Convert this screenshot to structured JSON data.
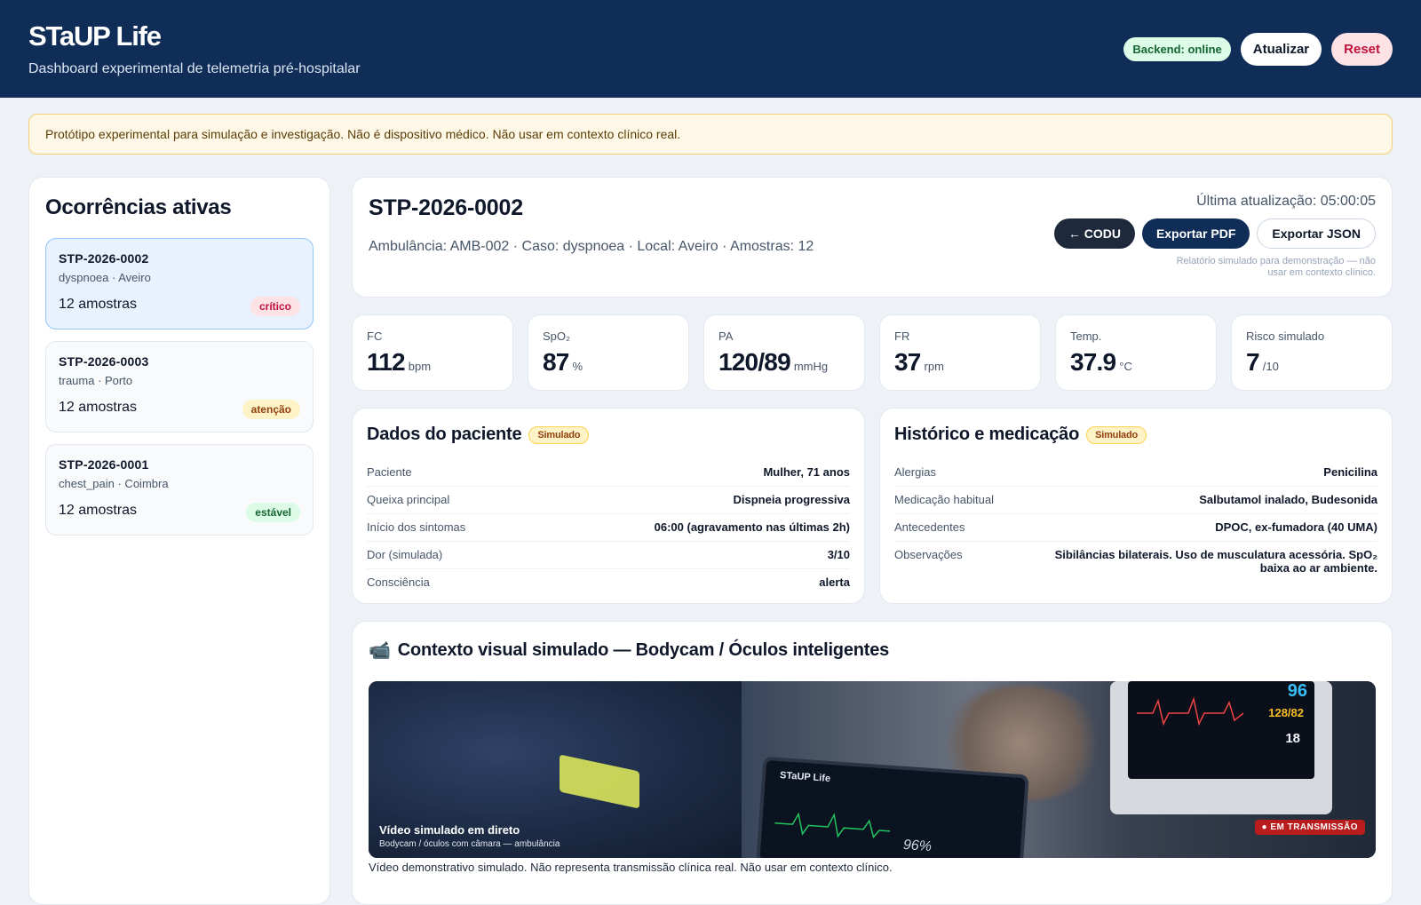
{
  "app": {
    "title": "STaUP Life",
    "subtitle": "Dashboard experimental de telemetria pré-hospitalar",
    "backend_status": "Backend: online",
    "refresh_label": "Atualizar",
    "reset_label": "Reset"
  },
  "disclaimer": "Protótipo experimental para simulação e investigação. Não é dispositivo médico. Não usar em contexto clínico real.",
  "sidebar": {
    "title": "Ocorrências ativas",
    "items": [
      {
        "id": "STP-2026-0002",
        "sub": "dyspnoea · Aveiro",
        "count": "12 amostras",
        "badge": "crítico"
      },
      {
        "id": "STP-2026-0003",
        "sub": "trauma · Porto",
        "count": "12 amostras",
        "badge": "atenção"
      },
      {
        "id": "STP-2026-0001",
        "sub": "chest_pain · Coimbra",
        "count": "12 amostras",
        "badge": "estável"
      }
    ]
  },
  "case": {
    "id": "STP-2026-0002",
    "meta": "Ambulância: AMB-002 · Caso: dyspnoea · Local: Aveiro · Amostras: 12",
    "last_update": "Última atualização: 05:00:05",
    "codu_label": "← CODU",
    "pdf_label": "Exportar PDF",
    "json_label": "Exportar JSON",
    "note": "Relatório simulado para demonstração — não usar em contexto clínico."
  },
  "vitals": [
    {
      "label": "FC",
      "value": "112",
      "unit": "bpm"
    },
    {
      "label": "SpO₂",
      "value": "87",
      "unit": "%"
    },
    {
      "label": "PA",
      "value": "120/89",
      "unit": "mmHg"
    },
    {
      "label": "FR",
      "value": "37",
      "unit": "rpm"
    },
    {
      "label": "Temp.",
      "value": "37.9",
      "unit": "°C"
    },
    {
      "label": "Risco simulado",
      "value": "7",
      "unit": "/10"
    }
  ],
  "patient": {
    "title": "Dados do paciente",
    "badge": "Simulado",
    "rows": [
      {
        "label": "Paciente",
        "value": "Mulher, 71 anos"
      },
      {
        "label": "Queixa principal",
        "value": "Dispneia progressiva"
      },
      {
        "label": "Início dos sintomas",
        "value": "06:00 (agravamento nas últimas 2h)"
      },
      {
        "label": "Dor (simulada)",
        "value": "3/10"
      },
      {
        "label": "Consciência",
        "value": "alerta"
      }
    ]
  },
  "history": {
    "title": "Histórico e medicação",
    "badge": "Simulado",
    "rows": [
      {
        "label": "Alergias",
        "value": "Penicilina"
      },
      {
        "label": "Medicação habitual",
        "value": "Salbutamol inalado, Budesonida"
      },
      {
        "label": "Antecedentes",
        "value": "DPOC, ex-fumadora (40 UMA)"
      },
      {
        "label": "Observações",
        "value": "Sibilâncias bilaterais. Uso de musculatura acessória. SpO₂ baixa ao ar ambiente."
      }
    ]
  },
  "video": {
    "icon": "📹",
    "title": "Contexto visual simulado — Bodycam / Óculos inteligentes",
    "caption_title": "Vídeo simulado em direto",
    "caption_sub": "Bodycam / óculos com câmara — ambulância",
    "live_label": "● EM TRANSMISSÃO",
    "tablet_title": "STaUP Life",
    "tablet_spo2": "96%",
    "monitor_hr": "96",
    "monitor_bp": "128/82",
    "monitor_rr": "18",
    "note": "Vídeo demonstrativo simulado. Não representa transmissão clínica real. Não usar em contexto clínico."
  },
  "colors": {
    "header_bg": "#0f2d57",
    "critical": "#be123c",
    "warning": "#92400e",
    "stable": "#166534"
  }
}
